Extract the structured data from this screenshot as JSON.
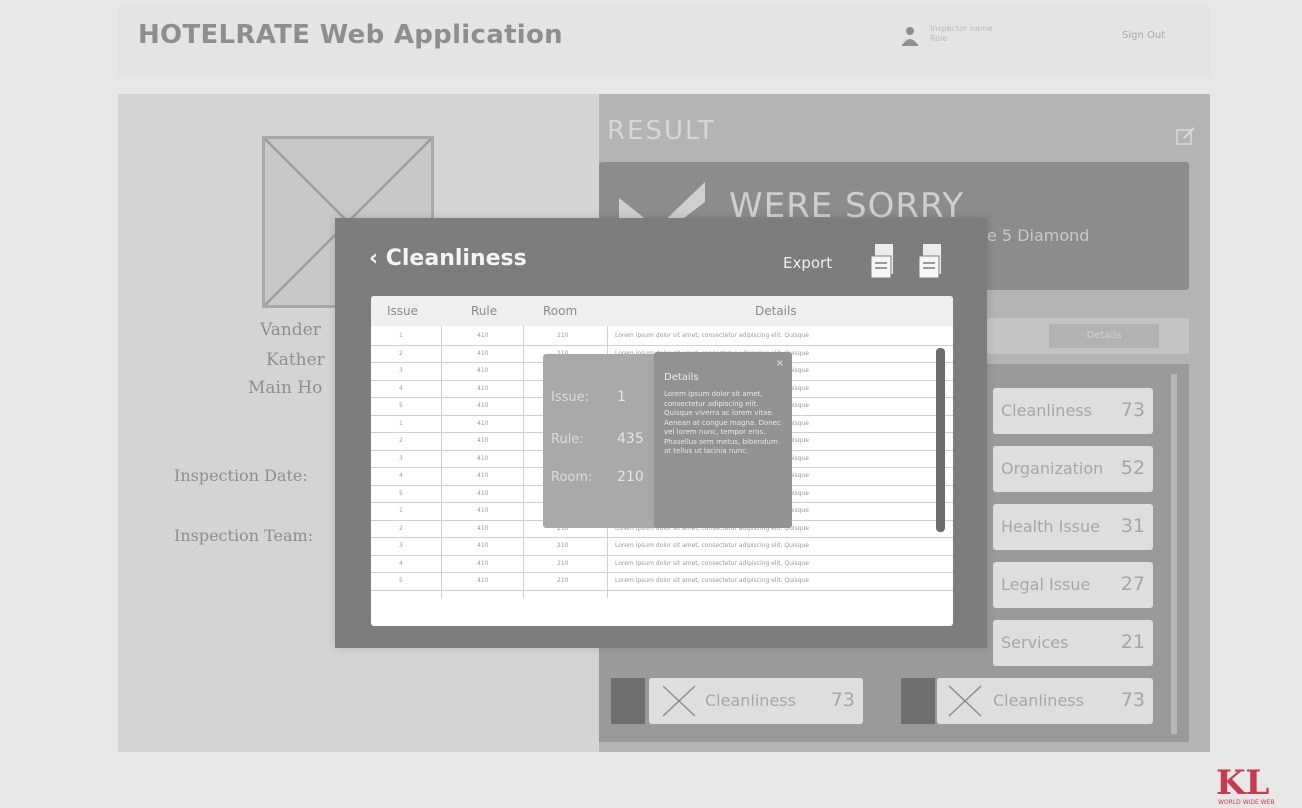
{
  "header": {
    "title": "HOTELRATE Web Application",
    "user_line1": "Inspector name",
    "user_line2": "Role",
    "signout": "Sign Out"
  },
  "left": {
    "line1": "Vander",
    "line2": "Kather",
    "line3": "Main Ho",
    "inspection_date_label": "Inspection Date:",
    "inspection_team_label": "Inspection Team:"
  },
  "result": {
    "title": "RESULT",
    "sorry": "WERE SORRY",
    "diamond": "e 5 Diamond",
    "filter_button": "Details",
    "categories": [
      {
        "label": "Cleanliness",
        "count": "73"
      },
      {
        "label": "Organization",
        "count": "52"
      },
      {
        "label": "Health Issue",
        "count": "31"
      },
      {
        "label": "Legal Issue",
        "count": "27"
      },
      {
        "label": "Services",
        "count": "21"
      },
      {
        "label": "Cleanliness",
        "count": "73"
      },
      {
        "label": "Cleanliness",
        "count": "73"
      }
    ]
  },
  "modal": {
    "back_label": "Cleanliness",
    "export_label": "Export",
    "columns": [
      "Issue",
      "Rule",
      "Room",
      "Details"
    ],
    "rows": [
      {
        "issue": "1",
        "rule": "410",
        "room": "210",
        "details": "Lorem ipsum dolor sit amet, consectetur adipiscing elit. Quisque"
      },
      {
        "issue": "2",
        "rule": "410",
        "room": "210",
        "details": "Lorem ipsum dolor sit amet, consectetur adipiscing elit. Quisque"
      },
      {
        "issue": "3",
        "rule": "410",
        "room": "210",
        "details": "Lorem ipsum dolor sit amet, consectetur adipiscing elit. Quisque"
      },
      {
        "issue": "4",
        "rule": "410",
        "room": "210",
        "details": "Lorem ipsum dolor sit amet, consectetur adipiscing elit. Quisque"
      },
      {
        "issue": "5",
        "rule": "410",
        "room": "210",
        "details": "Lorem ipsum dolor sit amet, consectetur adipiscing elit. Quisque"
      },
      {
        "issue": "1",
        "rule": "410",
        "room": "210",
        "details": "Lorem ipsum dolor sit amet, consectetur adipiscing elit. Quisque"
      },
      {
        "issue": "2",
        "rule": "410",
        "room": "210",
        "details": "Lorem ipsum dolor sit amet, consectetur adipiscing elit. Quisque"
      },
      {
        "issue": "3",
        "rule": "410",
        "room": "210",
        "details": "Lorem ipsum dolor sit amet, consectetur adipiscing elit. Quisque"
      },
      {
        "issue": "4",
        "rule": "410",
        "room": "210",
        "details": "Lorem ipsum dolor sit amet, consectetur adipiscing elit. Quisque"
      },
      {
        "issue": "5",
        "rule": "410",
        "room": "210",
        "details": "Lorem ipsum dolor sit amet, consectetur adipiscing elit. Quisque"
      },
      {
        "issue": "1",
        "rule": "410",
        "room": "210",
        "details": "Lorem ipsum dolor sit amet, consectetur adipiscing elit. Quisque"
      },
      {
        "issue": "2",
        "rule": "410",
        "room": "210",
        "details": "Lorem ipsum dolor sit amet, consectetur adipiscing elit. Quisque"
      },
      {
        "issue": "3",
        "rule": "410",
        "room": "210",
        "details": "Lorem ipsum dolor sit amet, consectetur adipiscing elit. Quisque"
      },
      {
        "issue": "4",
        "rule": "410",
        "room": "210",
        "details": "Lorem ipsum dolor sit amet, consectetur adipiscing elit. Quisque"
      },
      {
        "issue": "5",
        "rule": "410",
        "room": "210",
        "details": "Lorem ipsum dolor sit amet, consectetur adipiscing elit. Quisque"
      }
    ]
  },
  "tooltip": {
    "issue_label": "Issue:",
    "issue_value": "1",
    "rule_label": "Rule:",
    "rule_value": "435",
    "room_label": "Room:",
    "room_value": "210"
  },
  "detail": {
    "title": "Details",
    "body": "Lorem ipsum dolor sit amet, consectetur adipiscing elit. Quisque viverra ac lorem vitae. Aenean at congue magna. Donec vel lorem nunc, tempor eros. Phasellus sem metus, bibendum at tellus ut lacinia nunc.",
    "close": "×"
  },
  "logo": {
    "text": "KL",
    "subtitle": "WORLD WIDE WEB"
  }
}
